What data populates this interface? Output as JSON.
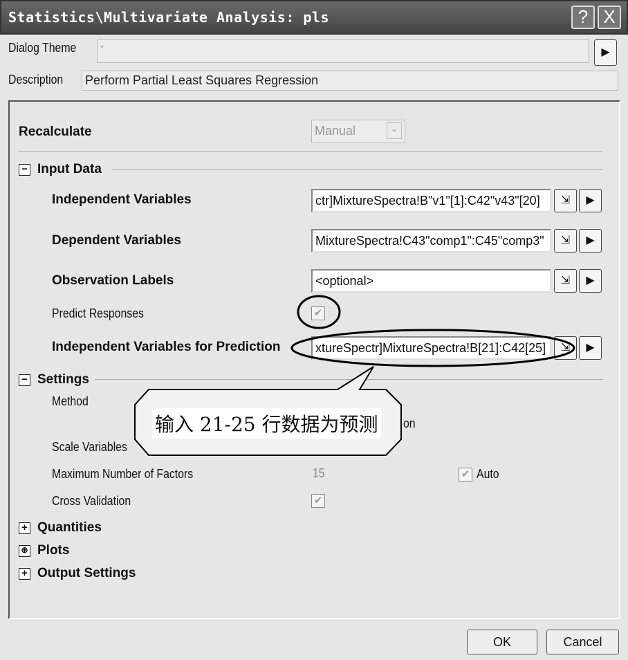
{
  "window": {
    "title": "Statistics\\Multivariate Analysis: pls",
    "help": "?",
    "close": "X"
  },
  "theme": {
    "label": "Dialog Theme",
    "value": "*"
  },
  "description": {
    "label": "Description",
    "value": "Perform Partial Least Squares Regression"
  },
  "recalculate": {
    "label": "Recalculate",
    "value": "Manual"
  },
  "input_data": {
    "header": "Input Data",
    "expanded": "−",
    "independent": {
      "label": "Independent Variables",
      "value": "ctr]MixtureSpectra!B\"v1\"[1]:C42\"v43\"[20]"
    },
    "dependent": {
      "label": "Dependent Variables",
      "value": "MixtureSpectra!C43\"comp1\":C45\"comp3\""
    },
    "observation": {
      "label": "Observation Labels",
      "value": "<optional>"
    },
    "predict": {
      "label": "Predict Responses",
      "checked": true
    },
    "prediction": {
      "label": "Independent Variables for Prediction",
      "value": "xtureSpectr]MixtureSpectra!B[21]:C42[25]"
    }
  },
  "settings": {
    "header": "Settings",
    "method": "Method",
    "method_value_tail": "on",
    "scale": "Scale Variables",
    "max_factors": "Maximum Number of Factors",
    "max_factors_value": "15",
    "auto": "Auto",
    "cross": "Cross Validation"
  },
  "collapsed": {
    "quantities": "Quantities",
    "plots": "Plots",
    "output": "Output Settings",
    "plus": "+",
    "plots_icon": "⊛"
  },
  "callout": {
    "text": "输入 21-25 行数据为预测"
  },
  "buttons": {
    "ok": "OK",
    "cancel": "Cancel"
  }
}
